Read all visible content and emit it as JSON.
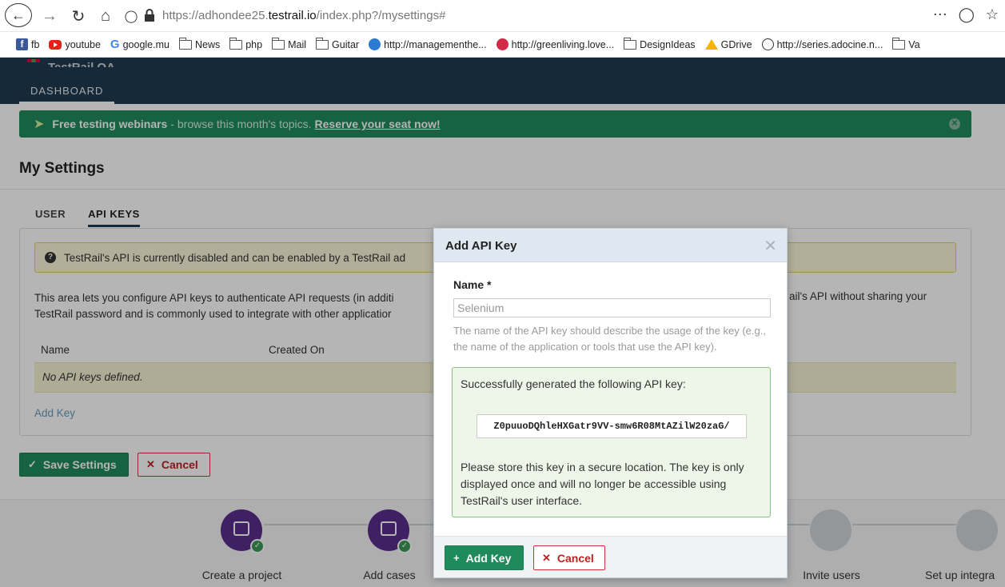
{
  "browser": {
    "url_prefix": "https://adhondee25.",
    "url_domain": "testrail.io",
    "url_path": "/index.php?/mysettings#",
    "bookmarks": [
      {
        "label": "fb",
        "icon": "facebook-icon"
      },
      {
        "label": "youtube",
        "icon": "youtube-icon"
      },
      {
        "label": "google.mu",
        "icon": "google-icon"
      },
      {
        "label": "News",
        "icon": "folder-icon"
      },
      {
        "label": "php",
        "icon": "folder-icon"
      },
      {
        "label": "Mail",
        "icon": "folder-icon"
      },
      {
        "label": "Guitar",
        "icon": "folder-icon"
      },
      {
        "label": "http://managementhe...",
        "icon": "site-icon"
      },
      {
        "label": "http://greenliving.love...",
        "icon": "site-icon"
      },
      {
        "label": "DesignIdeas",
        "icon": "folder-icon"
      },
      {
        "label": "GDrive",
        "icon": "gdrive-icon"
      },
      {
        "label": "http://series.adocine.n...",
        "icon": "globe-icon"
      },
      {
        "label": "Va",
        "icon": "folder-icon"
      }
    ]
  },
  "app": {
    "title": "TestRail QA",
    "nav_tab": "DASHBOARD"
  },
  "banner": {
    "bold": "Free testing webinars",
    "rest": "- browse this month's topics.",
    "link": "Reserve your seat now!"
  },
  "page": {
    "title": "My Settings",
    "tabs": [
      {
        "label": "USER"
      },
      {
        "label": "API KEYS"
      }
    ],
    "warning": "TestRail's API is currently disabled and can be enabled by a TestRail ad",
    "desc_line1": "This area lets you configure API keys to authenticate API requests (in additi",
    "desc_line1_right": "ail's API without sharing your",
    "desc_line2": "TestRail password and is commonly used to integrate with other applicatior",
    "table_headers": {
      "name": "Name",
      "created_on": "Created On"
    },
    "empty_text": "No API keys defined.",
    "add_key_link": "Add Key",
    "save_button": "Save Settings",
    "cancel_button": "Cancel"
  },
  "steps": [
    {
      "label": "Create a project",
      "done": true
    },
    {
      "label": "Add cases",
      "done": true
    },
    {
      "label": "Invite users",
      "done": false
    },
    {
      "label": "Set up integra",
      "done": false
    }
  ],
  "dialog": {
    "title": "Add API Key",
    "name_label": "Name *",
    "name_value": "Selenium",
    "help_text": "The name of the API key should describe the usage of the key (e.g., the name of the application or tools that use the API key).",
    "success_title": "Successfully generated the following API key:",
    "api_key": "Z0puuoDQhleHXGatr9VV-smw6R08MtAZilW20zaG/",
    "success_note": "Please store this key in a secure location. The key is only displayed once and will no longer be accessible using TestRail's user interface.",
    "add_button": "Add Key",
    "cancel_button": "Cancel"
  },
  "colors": {
    "header_bg": "#1e3a4f",
    "banner_bg": "#1f8a5c",
    "success_border": "#84c27c",
    "cancel_red": "#bb2222"
  }
}
